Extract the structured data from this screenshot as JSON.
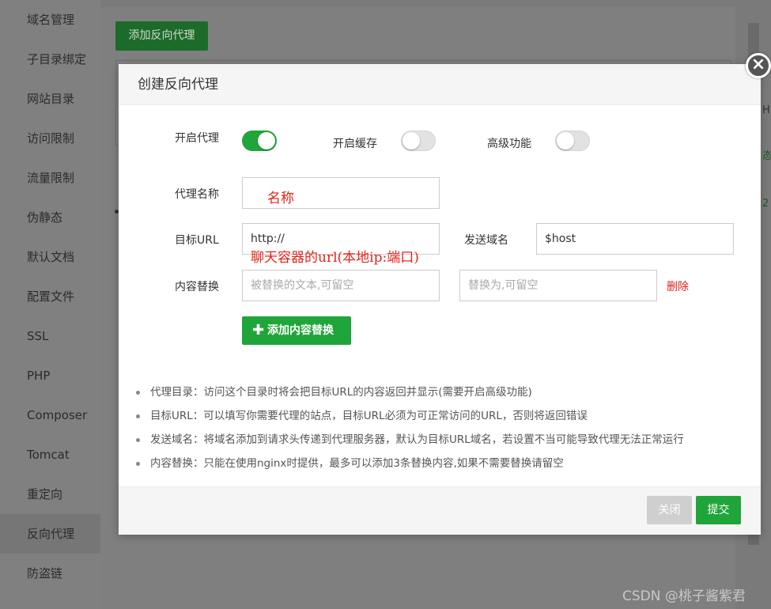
{
  "sidebar": {
    "items": [
      {
        "label": "域名管理"
      },
      {
        "label": "子目录绑定"
      },
      {
        "label": "网站目录"
      },
      {
        "label": "访问限制"
      },
      {
        "label": "流量限制"
      },
      {
        "label": "伪静态"
      },
      {
        "label": "默认文档"
      },
      {
        "label": "配置文件"
      },
      {
        "label": "SSL"
      },
      {
        "label": "PHP"
      },
      {
        "label": "Composer"
      },
      {
        "label": "Tomcat"
      },
      {
        "label": "重定向"
      },
      {
        "label": "反向代理"
      },
      {
        "label": "防盗链"
      }
    ],
    "active_index": 13
  },
  "background": {
    "add_proxy_button": "添加反向代理",
    "fragment_1": "H",
    "fragment_2": "态",
    "fragment_3": "2"
  },
  "modal": {
    "title": "创建反向代理",
    "close_symbol": "×",
    "toggles": {
      "enable_proxy": {
        "label": "开启代理",
        "on": true
      },
      "enable_cache": {
        "label": "开启缓存",
        "on": false
      },
      "advanced": {
        "label": "高级功能",
        "on": false
      }
    },
    "proxy_name": {
      "label": "代理名称",
      "value": "",
      "annotation": "名称"
    },
    "target_url": {
      "label": "目标URL",
      "value": "http://",
      "annotation": "聊天容器的url(本地ip:端口)"
    },
    "send_domain": {
      "label": "发送域名",
      "value": "$host"
    },
    "content_replace": {
      "label": "内容替换",
      "from_placeholder": "被替换的文本,可留空",
      "to_placeholder": "替换为,可留空",
      "delete_label": "删除"
    },
    "add_content_button": "添加内容替换",
    "add_icon": "✚",
    "tips": [
      "代理目录：访问这个目录时将会把目标URL的内容返回并显示(需要开启高级功能)",
      "目标URL：可以填写你需要代理的站点，目标URL必须为可正常访问的URL，否则将返回错误",
      "发送域名：将域名添加到请求头传递到代理服务器，默认为目标URL域名，若设置不当可能导致代理无法正常运行",
      "内容替换：只能在使用nginx时提供，最多可以添加3条替换内容,如果不需要替换请留空"
    ],
    "footer": {
      "close_label": "关闭",
      "submit_label": "提交"
    }
  },
  "watermark": "CSDN @桃子酱紫君",
  "colors": {
    "primary_green": "#20a53a",
    "danger_red": "#e0251b"
  }
}
